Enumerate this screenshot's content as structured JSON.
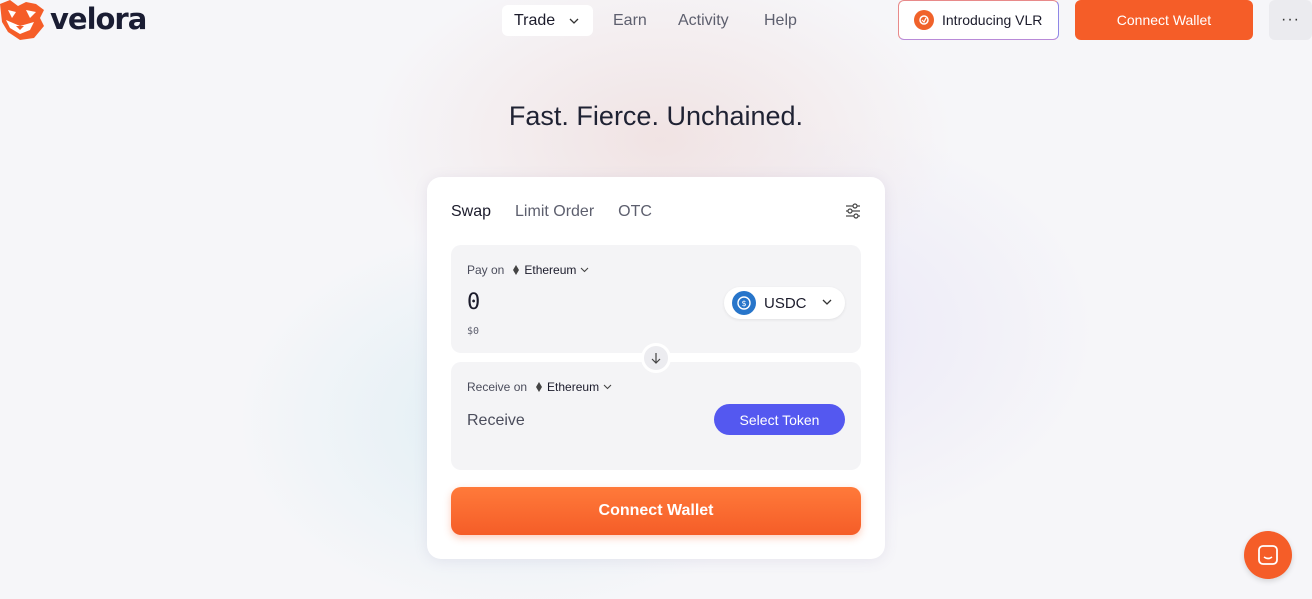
{
  "brand": {
    "name": "velora",
    "accent": "#f55d28",
    "secondary": "#5458f0"
  },
  "nav": {
    "trade_label": "Trade",
    "earn_label": "Earn",
    "activity_label": "Activity",
    "help_label": "Help"
  },
  "header": {
    "intro_label": "Introducing VLR",
    "connect_label": "Connect Wallet",
    "more_label": "···"
  },
  "hero": {
    "title": "Fast. Fierce. Unchained."
  },
  "swap": {
    "tabs": [
      {
        "label": "Swap",
        "active": true
      },
      {
        "label": "Limit Order",
        "active": false
      },
      {
        "label": "OTC",
        "active": false
      }
    ],
    "pay": {
      "label": "Pay on",
      "network": "Ethereum",
      "amount": "0",
      "usd_value": "$0",
      "token": "USDC",
      "token_icon": "usdc-icon"
    },
    "receive": {
      "label": "Receive on",
      "network": "Ethereum",
      "placeholder": "Receive",
      "select_label": "Select Token"
    },
    "connect_label": "Connect Wallet"
  },
  "icons": {
    "settings": "sliders-icon",
    "swap_direction": "arrow-down-icon",
    "chat": "chat-icon",
    "network": "ethereum-icon"
  }
}
